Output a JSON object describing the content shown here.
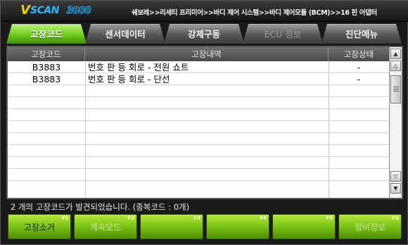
{
  "app": {
    "logo_v": "V",
    "logo_text": "SCAN",
    "logo_number": "3000",
    "breadcrumb": "쉐보레>>리세티 프리미어>>바디 제어 시스템>>바디 제어모듈 (BCM)>>16 핀 어댑터"
  },
  "tabs": [
    {
      "label": "고장코드",
      "state": "active"
    },
    {
      "label": "센서데이터",
      "state": "normal"
    },
    {
      "label": "강제구동",
      "state": "normal"
    },
    {
      "label": "ECU 정보",
      "state": "disabled"
    },
    {
      "label": "진단메뉴",
      "state": "normal"
    }
  ],
  "table": {
    "headers": [
      "고장코드",
      "고장내역",
      "고장상태"
    ],
    "rows": [
      {
        "code": "B3883",
        "description": "번호 판 등 회로 - 전원 쇼트",
        "status": "-"
      },
      {
        "code": "B3883",
        "description": "번호 판 등 회로 - 단선",
        "status": "-"
      }
    ]
  },
  "status_message": "2 개의 고장코드가 발견되었습니다. (중복코드 :  0개)",
  "function_keys": [
    {
      "key": "F1",
      "label": "고장소거",
      "enabled": true
    },
    {
      "key": "F2",
      "label": "계속모드",
      "enabled": false
    },
    {
      "key": "F3",
      "label": "",
      "enabled": false
    },
    {
      "key": "F4",
      "label": "",
      "enabled": false
    },
    {
      "key": "F5",
      "label": "",
      "enabled": false
    },
    {
      "key": "F6",
      "label": "정비정보",
      "enabled": false
    }
  ],
  "colors": {
    "accent_green": "#79c214",
    "logo_yellow": "#e8d200",
    "logo_blue": "#2fb7ff"
  },
  "icons": {
    "scroll_top": "double-up-arrow-icon",
    "scroll_up": "up-arrow-icon",
    "scroll_down": "down-arrow-icon",
    "scroll_bottom": "double-down-arrow-icon"
  }
}
